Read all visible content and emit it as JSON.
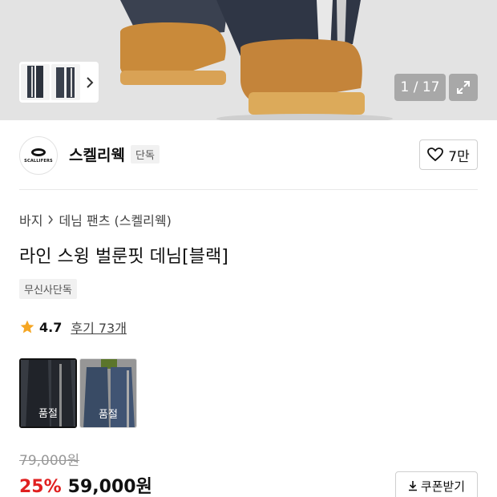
{
  "gallery": {
    "counter": "1 / 17",
    "icons": {
      "next": "chevron-right-icon",
      "expand": "expand-icon"
    }
  },
  "brand": {
    "logo_text": "SCALLIFERS",
    "name": "스켈리웩",
    "tag": "단독",
    "like_count": "7만"
  },
  "breadcrumb": [
    "바지",
    "데님 팬츠 (스켈리웩)"
  ],
  "product": {
    "title": "라인 스윙 벌룬핏 데님[블랙]",
    "exclusive_tag": "무신사단독",
    "rating": "4.7",
    "reviews": "후기 73개"
  },
  "variants": [
    {
      "label": "품절",
      "selected": true
    },
    {
      "label": "품절",
      "selected": false
    }
  ],
  "price": {
    "original": "79,000원",
    "discount": "25%",
    "sale": "59,000원"
  },
  "coupon": {
    "label": "쿠폰받기"
  },
  "colors": {
    "accent_red": "#e02020",
    "star": "#f5a623"
  }
}
